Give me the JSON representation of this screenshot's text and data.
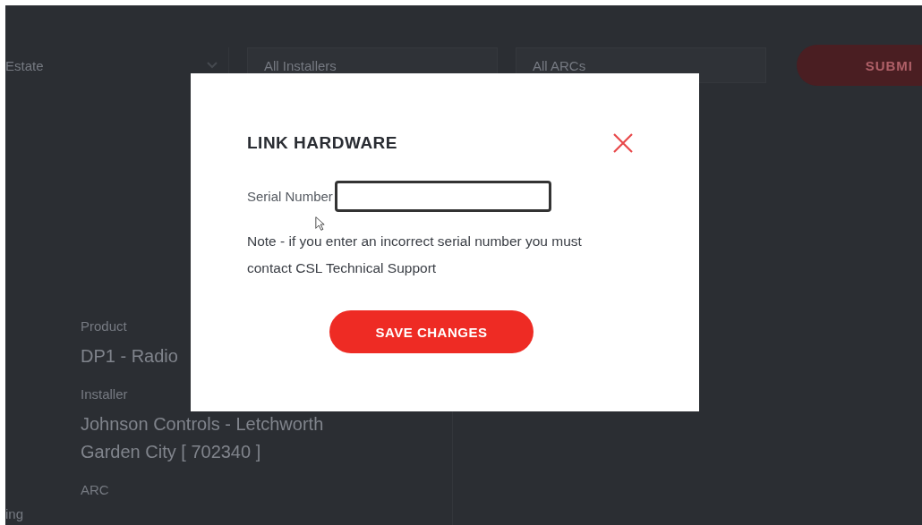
{
  "filters": [
    {
      "kind": "select",
      "label": "Estate"
    },
    {
      "kind": "field",
      "label": "All Installers"
    },
    {
      "kind": "field",
      "label": "All ARCs"
    }
  ],
  "submit_button": "SUBMI",
  "side_label": "ing",
  "details": [
    {
      "label": "Product",
      "value": "DP1 - Radio"
    },
    {
      "label": "Installer",
      "value": "Johnson Controls - Letchworth Garden City [ 702340 ]"
    },
    {
      "label": "ARC"
    }
  ],
  "dialog": {
    "title": "LINK HARDWARE",
    "field_label": "Serial Number",
    "note": "Note - if you enter an incorrect serial number you must contact CSL Technical Support",
    "button": "SAVE CHANGES"
  }
}
